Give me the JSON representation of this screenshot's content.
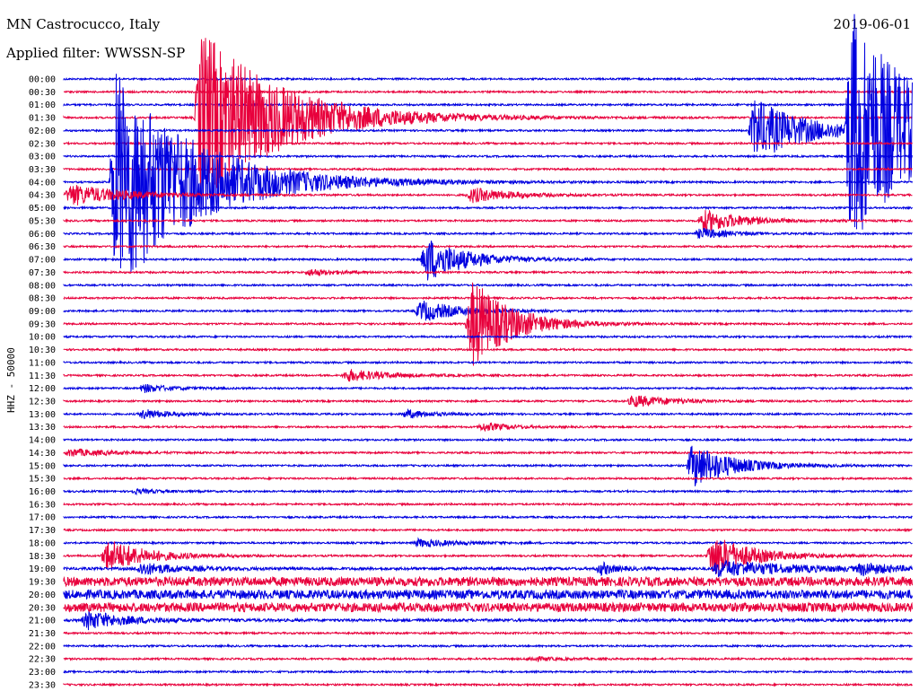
{
  "header": {
    "station": "MN Castrocucco, Italy",
    "date": "2019-06-01",
    "filter": "Applied filter: WWSSN-SP"
  },
  "chart_data": {
    "type": "line",
    "ylabel": "HHZ - 50000",
    "row_labels": [
      "00:00",
      "00:30",
      "01:00",
      "01:30",
      "02:00",
      "02:30",
      "03:00",
      "03:30",
      "04:00",
      "04:30",
      "05:00",
      "05:30",
      "06:00",
      "06:30",
      "07:00",
      "07:30",
      "08:00",
      "08:30",
      "09:00",
      "09:30",
      "10:00",
      "10:30",
      "11:00",
      "11:30",
      "12:00",
      "12:30",
      "13:00",
      "13:30",
      "14:00",
      "14:30",
      "15:00",
      "15:30",
      "16:00",
      "16:30",
      "17:00",
      "17:30",
      "18:00",
      "18:30",
      "19:00",
      "19:30",
      "20:00",
      "20:30",
      "21:00",
      "21:30",
      "22:00",
      "22:30",
      "23:00",
      "23:30"
    ],
    "row_colors": [
      "#0000e0",
      "#e8003c"
    ],
    "trace_minutes": 30,
    "noise_levels": [
      1,
      1,
      1,
      1,
      1,
      1,
      1,
      1,
      1,
      1,
      1,
      1,
      1,
      1,
      1,
      1,
      1,
      1,
      1,
      1,
      1,
      1,
      1,
      1,
      1,
      1,
      1,
      1,
      1,
      1,
      1,
      1,
      1,
      1,
      1,
      1,
      1,
      1,
      1.5,
      5,
      5,
      5,
      1.5,
      1,
      1,
      1,
      1,
      1
    ],
    "events": [
      {
        "row": 8,
        "minute": 1.6,
        "amp": 140,
        "dur": 6
      },
      {
        "row": 9,
        "minute": 0.0,
        "amp": 14,
        "dur": 4
      },
      {
        "row": 3,
        "minute": 4.6,
        "amp": 110,
        "dur": 6
      },
      {
        "row": 9,
        "minute": 14.2,
        "amp": 10,
        "dur": 3
      },
      {
        "row": 14,
        "minute": 12.6,
        "amp": 30,
        "dur": 3
      },
      {
        "row": 18,
        "minute": 12.4,
        "amp": 14,
        "dur": 3
      },
      {
        "row": 19,
        "minute": 14.2,
        "amp": 60,
        "dur": 3
      },
      {
        "row": 4,
        "minute": 24.2,
        "amp": 40,
        "dur": 4
      },
      {
        "row": 11,
        "minute": 22.4,
        "amp": 15,
        "dur": 3
      },
      {
        "row": 4,
        "minute": 27.6,
        "amp": 150,
        "dur": 5
      },
      {
        "row": 12,
        "minute": 22.3,
        "amp": 8,
        "dur": 2
      },
      {
        "row": 15,
        "minute": 8.5,
        "amp": 5,
        "dur": 2
      },
      {
        "row": 23,
        "minute": 9.8,
        "amp": 8,
        "dur": 3
      },
      {
        "row": 24,
        "minute": 2.6,
        "amp": 6,
        "dur": 2
      },
      {
        "row": 25,
        "minute": 19.9,
        "amp": 8,
        "dur": 3
      },
      {
        "row": 26,
        "minute": 2.6,
        "amp": 7,
        "dur": 2
      },
      {
        "row": 26,
        "minute": 11.9,
        "amp": 6,
        "dur": 2
      },
      {
        "row": 27,
        "minute": 14.6,
        "amp": 6,
        "dur": 2
      },
      {
        "row": 29,
        "minute": 0.0,
        "amp": 5,
        "dur": 3
      },
      {
        "row": 30,
        "minute": 22.0,
        "amp": 30,
        "dur": 3
      },
      {
        "row": 32,
        "minute": 2.3,
        "amp": 3,
        "dur": 2
      },
      {
        "row": 36,
        "minute": 12.3,
        "amp": 5,
        "dur": 3
      },
      {
        "row": 37,
        "minute": 1.3,
        "amp": 22,
        "dur": 3
      },
      {
        "row": 37,
        "minute": 22.7,
        "amp": 28,
        "dur": 3
      },
      {
        "row": 38,
        "minute": 2.5,
        "amp": 8,
        "dur": 3
      },
      {
        "row": 38,
        "minute": 18.8,
        "amp": 12,
        "dur": 1
      },
      {
        "row": 38,
        "minute": 22.9,
        "amp": 10,
        "dur": 6
      },
      {
        "row": 38,
        "minute": 28.0,
        "amp": 8,
        "dur": 2
      },
      {
        "row": 42,
        "minute": 0.6,
        "amp": 12,
        "dur": 3
      },
      {
        "row": 45,
        "minute": 16.3,
        "amp": 3,
        "dur": 2
      }
    ]
  }
}
